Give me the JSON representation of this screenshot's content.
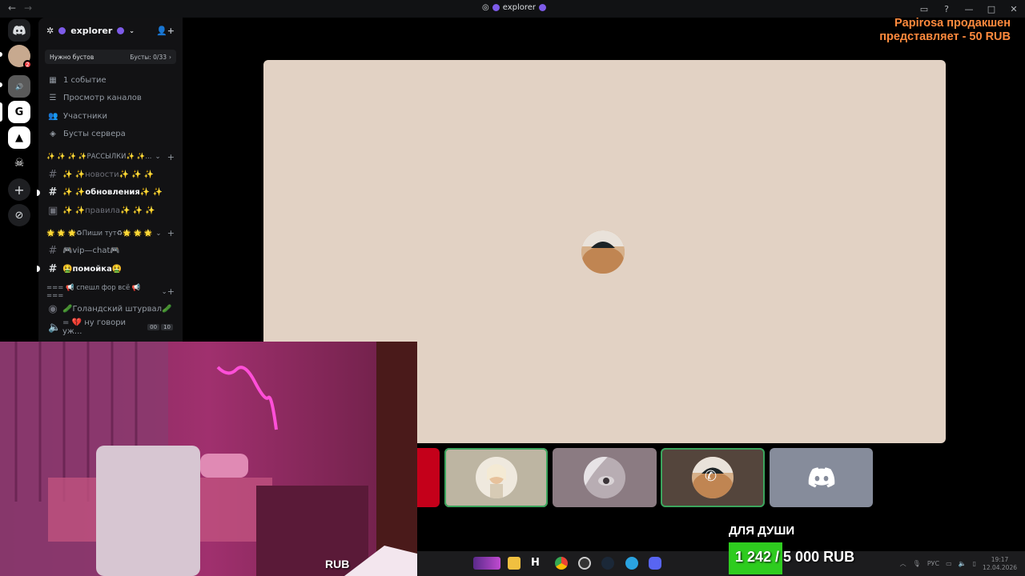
{
  "titlebar": {
    "server_name": "explorer",
    "back": "←",
    "forward": "→"
  },
  "donation_top": {
    "line1": "Papirosa продакшен",
    "line2": "представляет - 50 RUB"
  },
  "server": {
    "name": "explorer"
  },
  "boost": {
    "label": "Нужно бустов",
    "status": "Бусты: 0/33"
  },
  "nav": [
    {
      "label": "1 событие",
      "icon": "calendar-icon"
    },
    {
      "label": "Просмотр каналов",
      "icon": "channels-icon"
    },
    {
      "label": "Участники",
      "icon": "members-icon"
    },
    {
      "label": "Бусты сервера",
      "icon": "boost-icon"
    }
  ],
  "categories": [
    {
      "label": "✨ ✨ ✨ ✨РАССЫЛКИ✨ ✨..."
    },
    {
      "label": "🌟 🌟 🌟♻Пиши тут♻🌟 🌟 🌟"
    },
    {
      "label": "=== 📢 спешл фор всё 📢 ==="
    }
  ],
  "channels": [
    {
      "label": "✨ ✨новости✨ ✨ ✨"
    },
    {
      "label": "✨ ✨обновления✨ ✨"
    },
    {
      "label": "✨ ✨правила✨ ✨ ✨"
    },
    {
      "label": "🎮vip—chat🎮"
    },
    {
      "label": "🤮помойка🤮"
    },
    {
      "label": "🥒Голандский штурвал🥒"
    },
    {
      "label": "= 💔 ну говори уж...",
      "count_a": "00",
      "count_b": "10"
    }
  ],
  "webcam": {
    "label": "RUB"
  },
  "goal": {
    "title": "ДЛЯ ДУШИ",
    "text": "1 242 / 5 000 RUB",
    "progress": 0.2484
  },
  "tray": {
    "lang": "РУС",
    "time": "19:17",
    "date": "12.04.2026"
  },
  "colors": {
    "accent": "#5865f2",
    "goal_green": "#2ecc1f",
    "donation_orange": "#ff8a3d",
    "stage_bg": "#e2d2c4"
  }
}
